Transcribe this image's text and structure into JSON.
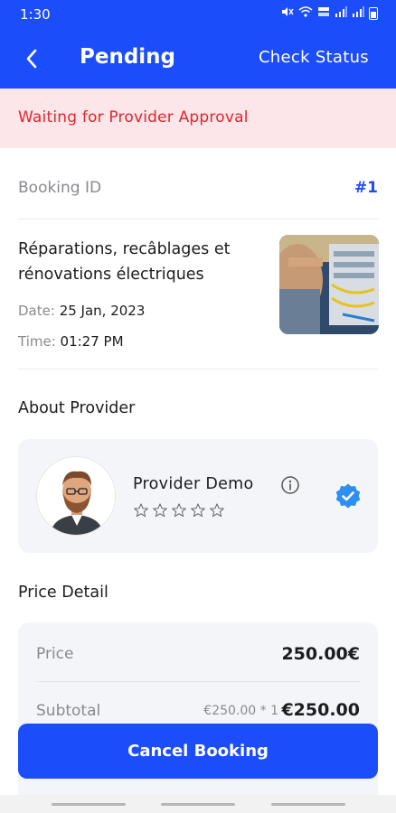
{
  "status_bar": {
    "time": "1:30",
    "icons": [
      "mute-icon",
      "wifi-icon",
      "volte-icon",
      "signal-icon",
      "signal-icon",
      "battery-icon"
    ]
  },
  "app_bar": {
    "title": "Pending",
    "action_label": "Check Status",
    "accent_color": "#1c4dfb"
  },
  "banner": {
    "text": "Waiting for Provider Approval",
    "color": "#e0262b",
    "background": "#fde6ea"
  },
  "booking": {
    "id_label": "Booking ID",
    "id_value": "#1",
    "service_name": "Réparations, recâblages et rénovations électriques",
    "date_label": "Date:",
    "date_value": "25 Jan, 2023",
    "time_label": "Time:",
    "time_value": "01:27 PM"
  },
  "provider": {
    "section_title": "About Provider",
    "name": "Provider Demo",
    "rating": 0,
    "max_rating": 5
  },
  "price": {
    "section_title": "Price Detail",
    "price_label": "Price",
    "price_value": "250.00€",
    "subtotal_label": "Subtotal",
    "subtotal_multiplier": "€250.00 * 1",
    "subtotal_value": "€250.00"
  },
  "actions": {
    "cancel_label": "Cancel Booking"
  }
}
